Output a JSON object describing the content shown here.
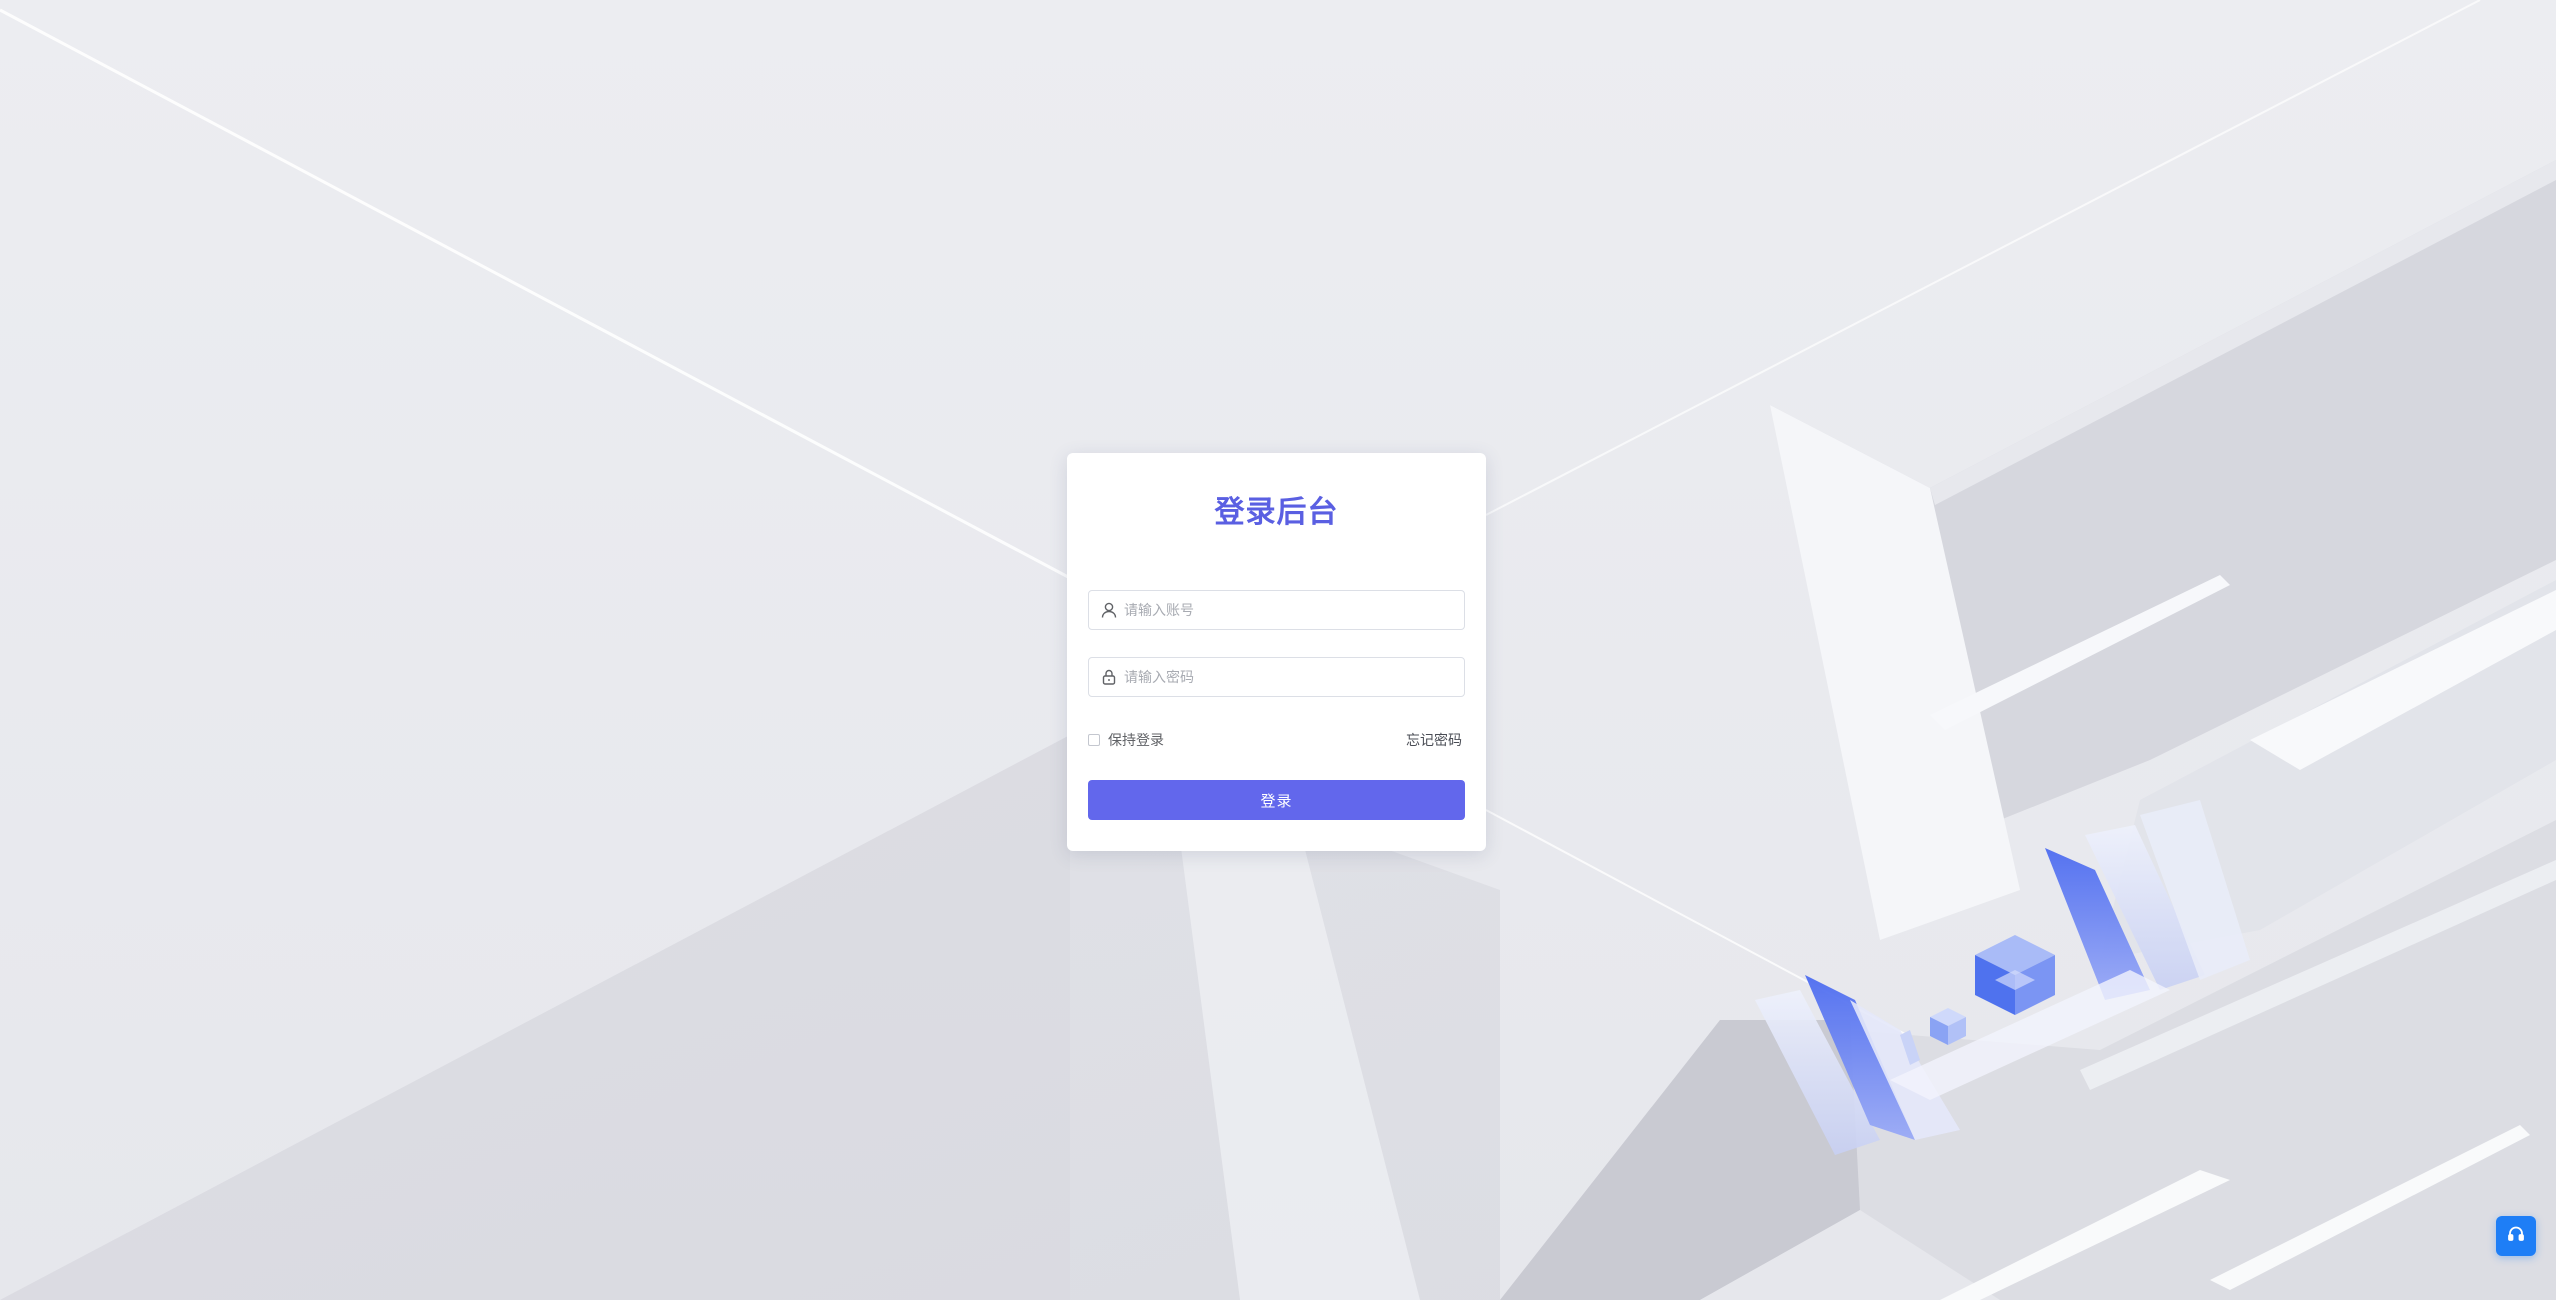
{
  "login": {
    "title": "登录后台",
    "username_placeholder": "请输入账号",
    "password_placeholder": "请输入密码",
    "remember_label": "保持登录",
    "forgot_label": "忘记密码",
    "submit_label": "登录"
  },
  "icons": {
    "username": "user-icon",
    "password": "lock-icon",
    "support": "headset-icon"
  },
  "colors": {
    "accent": "#5a5fe2",
    "button": "#6267ec",
    "support": "#1e7ef6",
    "background": "#e9eaee"
  }
}
